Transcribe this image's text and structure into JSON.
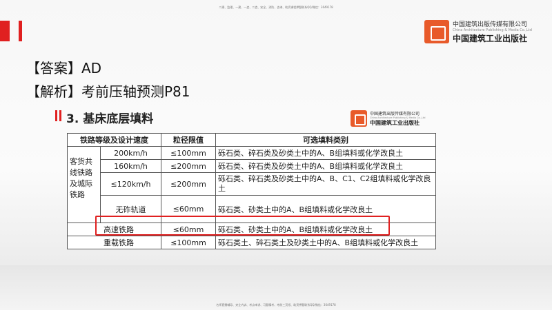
{
  "watermark_top": "二建、监理、一建、一造、二造、安全、消防、咨询、助资课程押题联系QQ/微信：3649178",
  "watermark_bottom": "名师直播辅导、央企内训、考点串讲、习题精考、考前三页纸、助资押题联系QQ/微信：3649178",
  "publisher": {
    "cn": "中国建筑出版传媒有限公司",
    "en": "China Architecture Publishing & Media Co.,Ltd",
    "calligraphy": "中国建筑工业出版社"
  },
  "answer": "【答案】AD",
  "analysis": "【解析】考前压轴预测P81",
  "slide": {
    "title": "3. 基床底层填料",
    "headers": [
      "铁路等级及设计速度",
      "粒径限值",
      "可选填料类别"
    ],
    "group_label": "客货共线铁路及城际铁路",
    "rows": [
      {
        "speed": "200km/h",
        "limit": "≤100mm",
        "fill": "砾石类、碎石类及砂类土中的A、B组填料或化学改良土"
      },
      {
        "speed": "160km/h",
        "limit": "≤200mm",
        "fill": "砾石类、碎石类及砂类土中的A、B组填料或化学改良土"
      },
      {
        "speed": "≤120km/h",
        "limit": "≤200mm",
        "fill": "砾石类、碎石类及砂类土中的A、B、C1、C2组填料或化学改良土"
      },
      {
        "speed": "无砟轨道",
        "limit": "≤60mm",
        "fill": "砾石类、砂类土中的A、B组填料或化学改良土"
      },
      {
        "speed": "高速铁路",
        "limit": "≤60mm",
        "fill": "砾石类、砂类土中的A、B组填料或化学改良土"
      },
      {
        "speed": "重载铁路",
        "limit": "≤100mm",
        "fill": "砾石类土、碎石类土及砂类土中的A、B组填料或化学改良土"
      }
    ]
  }
}
